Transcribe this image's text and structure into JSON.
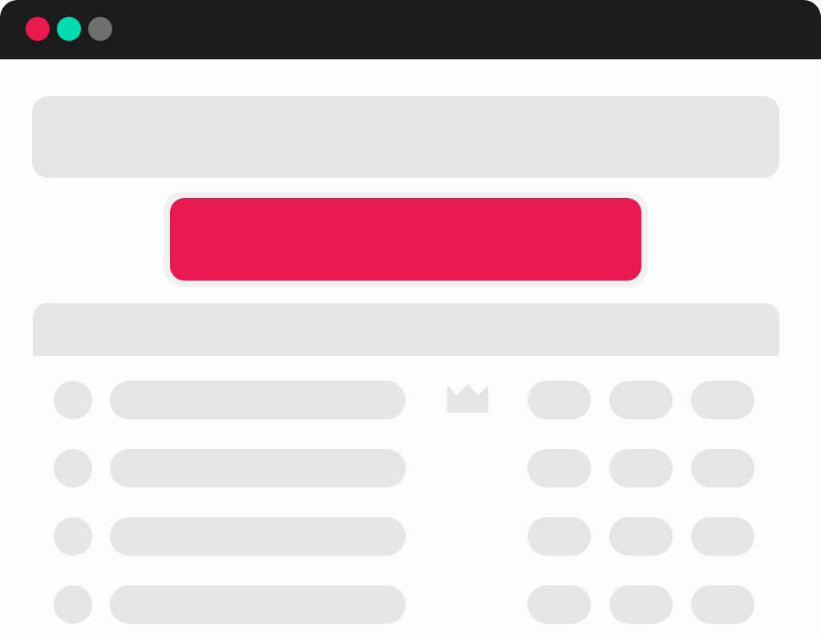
{
  "window": {
    "titlebar_color": "#1b1b1b",
    "controls": [
      {
        "name": "close",
        "color": "#e8194f"
      },
      {
        "name": "maximize",
        "color": "#00dcb0"
      },
      {
        "name": "minimize",
        "color": "#6f6f6f"
      }
    ]
  },
  "colors": {
    "placeholder": "#e6e6e6",
    "accent": "#e8194f",
    "accent_outline": "#f1f1f1"
  },
  "leaderboard": {
    "rows": [
      {
        "badge": "crown-icon"
      },
      {
        "badge": null
      },
      {
        "badge": null
      },
      {
        "badge": null
      }
    ]
  }
}
